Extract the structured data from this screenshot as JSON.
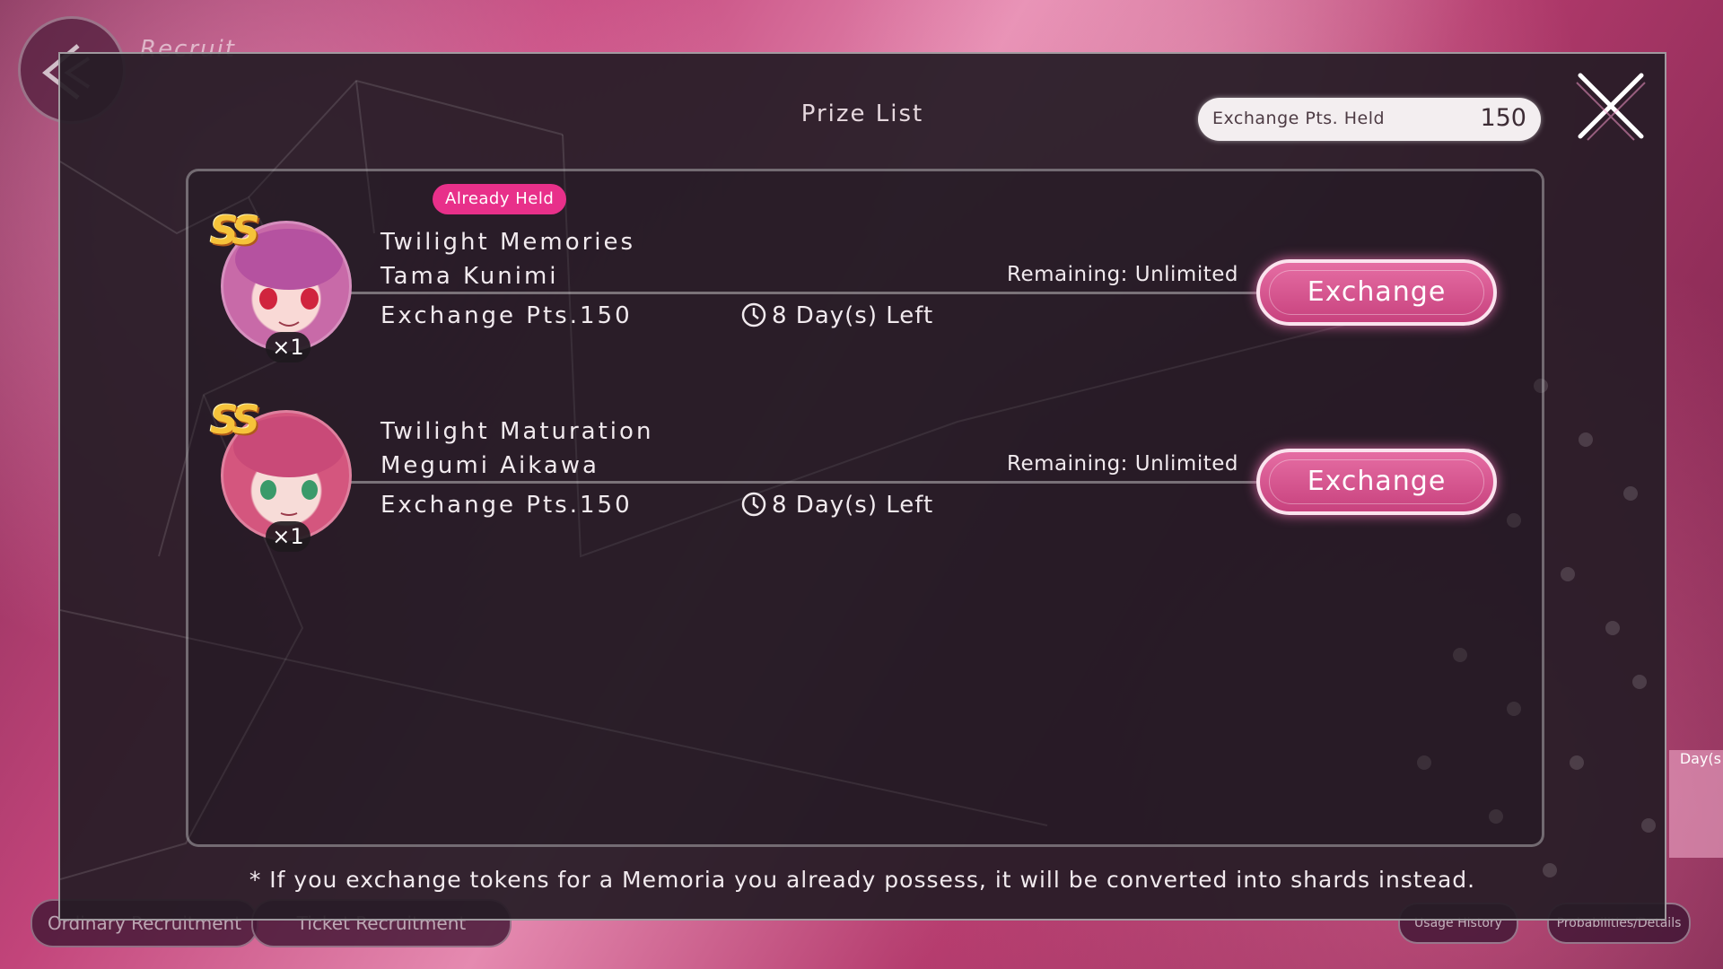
{
  "background": {
    "page_title": "Recruit",
    "tabs": [
      "Ordinary Recruitment",
      "Ticket Recruitment"
    ],
    "right_buttons": [
      "Usage History",
      "Probabilities/Details"
    ],
    "side_label": "Day(s"
  },
  "modal": {
    "title": "Prize List",
    "points_label": "Exchange Pts. Held",
    "points_value": "150",
    "footer_note": "* If you exchange tokens for a Memoria you already possess, it will be converted into shards instead."
  },
  "prizes": [
    {
      "name": "Twilight Memories",
      "character": "Tama Kunimi",
      "cost": "Exchange Pts.150",
      "time_left": "8 Day(s) Left",
      "remaining": "Remaining: Unlimited",
      "rarity": "SS",
      "count": "×1",
      "badge": "Already Held",
      "button": "Exchange",
      "hair_color": "#c86aa8"
    },
    {
      "name": "Twilight Maturation",
      "character": "Megumi Aikawa",
      "cost": "Exchange Pts.150",
      "time_left": "8 Day(s) Left",
      "remaining": "Remaining: Unlimited",
      "rarity": "SS",
      "count": "×1",
      "badge": "",
      "button": "Exchange",
      "hair_color": "#d4567e"
    }
  ],
  "colors": {
    "accent": "#e8308a",
    "button": "#d8558f",
    "rarity": "#f6c33a"
  }
}
